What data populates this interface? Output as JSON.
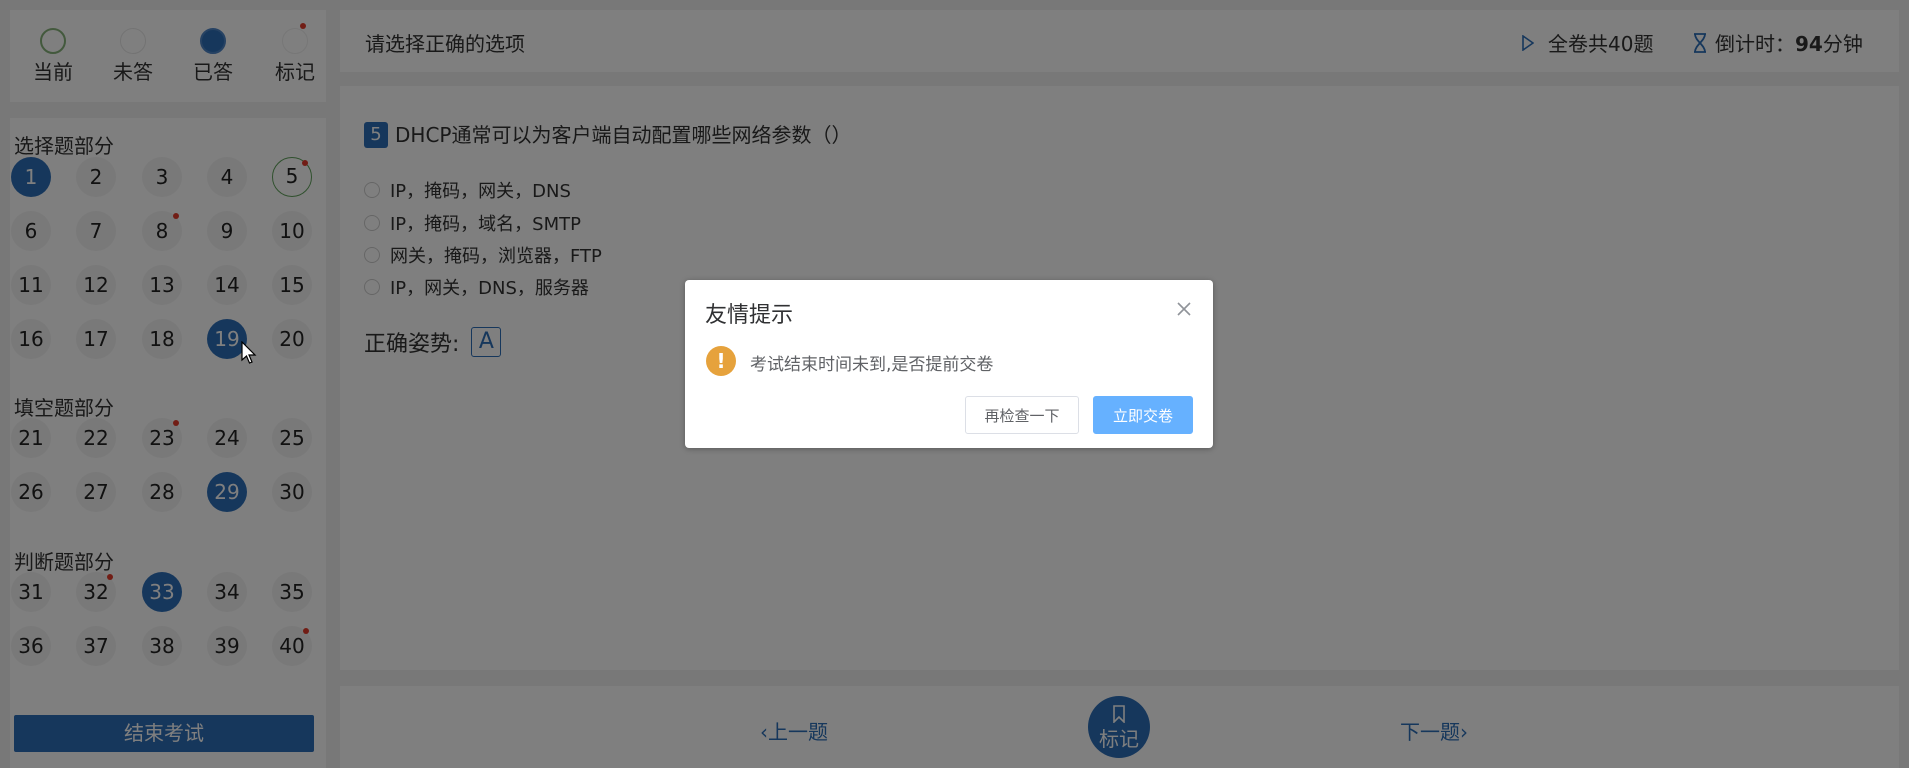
{
  "legend": {
    "items": [
      {
        "label": "当前",
        "state": "current"
      },
      {
        "label": "未答",
        "state": "unanswered"
      },
      {
        "label": "已答",
        "state": "answered"
      },
      {
        "label": "标记",
        "state": "marked"
      }
    ]
  },
  "nav": {
    "sections": [
      {
        "title": "选择题部分",
        "questions": [
          {
            "num": "1",
            "state": "current"
          },
          {
            "num": "2"
          },
          {
            "num": "3"
          },
          {
            "num": "4"
          },
          {
            "num": "5",
            "state": "active",
            "marked": true
          },
          {
            "num": "6"
          },
          {
            "num": "7"
          },
          {
            "num": "8",
            "marked": true
          },
          {
            "num": "9"
          },
          {
            "num": "10"
          },
          {
            "num": "11"
          },
          {
            "num": "12"
          },
          {
            "num": "13"
          },
          {
            "num": "14"
          },
          {
            "num": "15"
          },
          {
            "num": "16"
          },
          {
            "num": "17"
          },
          {
            "num": "18"
          },
          {
            "num": "19",
            "state": "answered"
          },
          {
            "num": "20"
          }
        ]
      },
      {
        "title": "填空题部分",
        "questions": [
          {
            "num": "21"
          },
          {
            "num": "22"
          },
          {
            "num": "23",
            "marked": true
          },
          {
            "num": "24"
          },
          {
            "num": "25"
          },
          {
            "num": "26"
          },
          {
            "num": "27"
          },
          {
            "num": "28"
          },
          {
            "num": "29",
            "state": "answered"
          },
          {
            "num": "30"
          }
        ]
      },
      {
        "title": "判断题部分",
        "questions": [
          {
            "num": "31"
          },
          {
            "num": "32",
            "marked": true
          },
          {
            "num": "33",
            "state": "answered"
          },
          {
            "num": "34"
          },
          {
            "num": "35"
          },
          {
            "num": "36"
          },
          {
            "num": "37"
          },
          {
            "num": "38"
          },
          {
            "num": "39"
          },
          {
            "num": "40",
            "marked": true
          }
        ]
      }
    ],
    "end_exam_label": "结束考试"
  },
  "topbar": {
    "instruction": "请选择正确的选项",
    "total_label": "全卷共40题",
    "countdown_prefix": "倒计时：",
    "countdown_value": "94",
    "countdown_unit": "分钟"
  },
  "question": {
    "number": "5",
    "text": "DHCP通常可以为客户端自动配置哪些网络参数（）",
    "options": [
      "IP，掩码，网关，DNS",
      "IP，掩码，域名，SMTP",
      "网关，掩码，浏览器，FTP",
      "IP，网关，DNS，服务器"
    ],
    "answer_label": "正确姿势:",
    "answer_value": "A"
  },
  "bottombar": {
    "prev_label": "上一题",
    "mark_label": "标记",
    "next_label": "下一题"
  },
  "dialog": {
    "title": "友情提示",
    "message": "考试结束时间未到,是否提前交卷",
    "recheck_label": "再检查一下",
    "submit_label": "立即交卷"
  },
  "colors": {
    "primary": "#2d6fb8",
    "current_border": "#86b37a",
    "mark_dot": "#e23b2b",
    "warning": "#e6a23c",
    "submit": "#66b1ff"
  }
}
